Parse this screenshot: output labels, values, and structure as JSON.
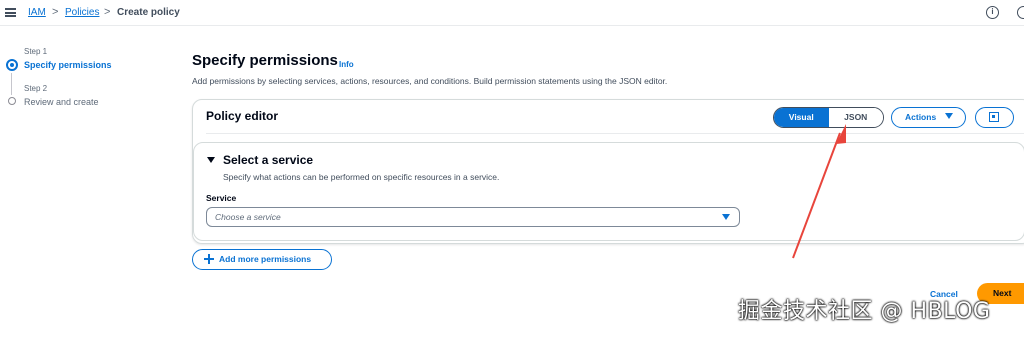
{
  "breadcrumb": {
    "items": [
      "IAM",
      "Policies",
      "Create policy"
    ],
    "separator": ">"
  },
  "header_icons": [
    "menu-icon",
    "info-icon",
    "settings-icon"
  ],
  "steps": [
    {
      "label": "Step 1",
      "title": "Specify permissions",
      "state": "active"
    },
    {
      "label": "Step 2",
      "title": "Review and create",
      "state": "inactive"
    }
  ],
  "page": {
    "title": "Specify permissions",
    "info_link": "Info",
    "description": "Add permissions by selecting services, actions, resources, and conditions. Build permission statements using the JSON editor."
  },
  "editor": {
    "title": "Policy editor",
    "toggle": {
      "options": [
        "Visual",
        "JSON"
      ],
      "selected": "Visual"
    },
    "actions_label": "Actions"
  },
  "service_section": {
    "title": "Select a service",
    "description": "Specify what actions can be performed on specific resources in a service.",
    "field_label": "Service",
    "placeholder": "Choose a service"
  },
  "add_more_label": "Add more permissions",
  "footer": {
    "cancel_label": "Cancel",
    "next_label": "Next"
  },
  "watermark": "掘金技术社区 @ HBLOG",
  "colors": {
    "accent": "#0972d3",
    "primary_button": "#ff9900",
    "annotation_arrow": "#e8453c"
  }
}
